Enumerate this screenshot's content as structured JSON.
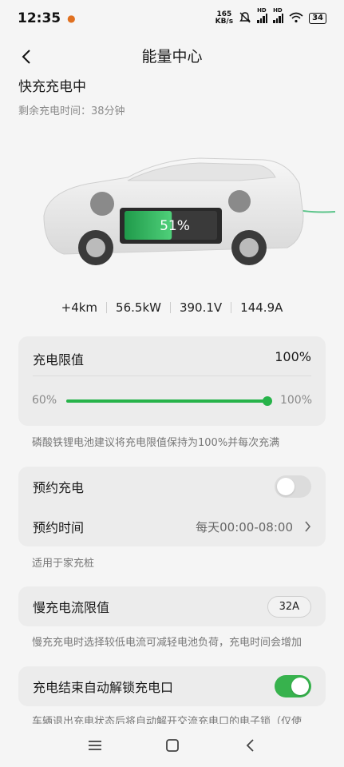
{
  "status_bar": {
    "time": "12:35",
    "net_speed_value": "165",
    "net_speed_unit": "KB/s",
    "hd1": "HD",
    "hd2": "HD",
    "battery": "34"
  },
  "header": {
    "title": "能量中心"
  },
  "charging": {
    "status": "快充充电中",
    "remaining_time": "剩余充电时间：38分钟",
    "battery_percent_label": "51%",
    "battery_level": 0.51
  },
  "metrics": [
    "+4km",
    "56.5kW",
    "390.1V",
    "144.9A"
  ],
  "charge_limit": {
    "title": "充电限值",
    "value": "100%",
    "min_label": "60%",
    "max_label": "100%",
    "slider_fraction": 1.0,
    "hint": "磷酸铁锂电池建议将充电限值保持为100%并每次充满"
  },
  "schedule": {
    "title": "预约充电",
    "enabled": false,
    "time_title": "预约时间",
    "time_value": "每天00:00-08:00",
    "hint": "适用于家充桩"
  },
  "slow_charge": {
    "title": "慢充电流限值",
    "value": "32A",
    "hint": "慢充充电时选择较低电流可减轻电池负荷，充电时间会增加"
  },
  "auto_unlock": {
    "title": "充电结束自动解锁充电口",
    "enabled": true,
    "hint": "车辆退出充电状态后将自动解开交流充电口的电子锁（仅使"
  },
  "colors": {
    "accent_green": "#27b34a",
    "toggle_on": "#37b24d",
    "card_bg": "#ececec",
    "page_bg": "#f5f5f5"
  }
}
